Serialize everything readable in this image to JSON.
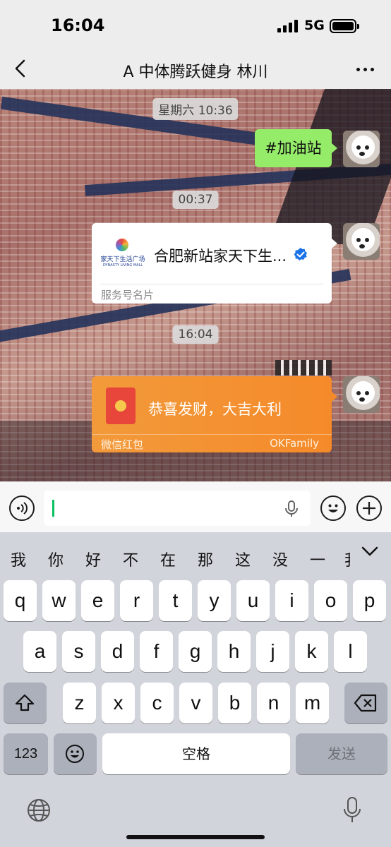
{
  "status_bar": {
    "time": "16:04",
    "network": "5G"
  },
  "nav": {
    "title": "A 中体腾跃健身 林川",
    "back_icon": "chevron-left-icon",
    "more_icon": "more-dots-icon"
  },
  "chat": {
    "messages": [
      {
        "type": "timestamp",
        "text": "星期六 10:36"
      },
      {
        "type": "text",
        "sender": "self",
        "text": "#加油站"
      },
      {
        "type": "timestamp",
        "text": "00:37"
      },
      {
        "type": "card",
        "sender": "self",
        "logo_text_cn": "家天下生活广场",
        "logo_text_en": "DYNASTY LIVING MALL",
        "name": "合肥新站家天下生...",
        "footer": "服务号名片"
      },
      {
        "type": "timestamp",
        "text": "16:04"
      },
      {
        "type": "red_packet",
        "sender": "self",
        "greeting": "恭喜发财，大吉大利",
        "label": "微信红包",
        "watermark": "OKFamily"
      }
    ]
  },
  "input_bar": {
    "value": ""
  },
  "keyboard": {
    "candidates": [
      "我",
      "你",
      "好",
      "不",
      "在",
      "那",
      "这",
      "没",
      "一",
      "我"
    ],
    "rows": [
      [
        "q",
        "w",
        "e",
        "r",
        "t",
        "y",
        "u",
        "i",
        "o",
        "p"
      ],
      [
        "a",
        "s",
        "d",
        "f",
        "g",
        "h",
        "j",
        "k",
        "l"
      ],
      [
        "z",
        "x",
        "c",
        "v",
        "b",
        "n",
        "m"
      ]
    ],
    "numbers_key": "123",
    "space_key": "空格",
    "send_key": "发送"
  },
  "colors": {
    "accent_green": "#07c160",
    "bubble_green": "#95ec69",
    "red_packet": "#f58a2a"
  }
}
